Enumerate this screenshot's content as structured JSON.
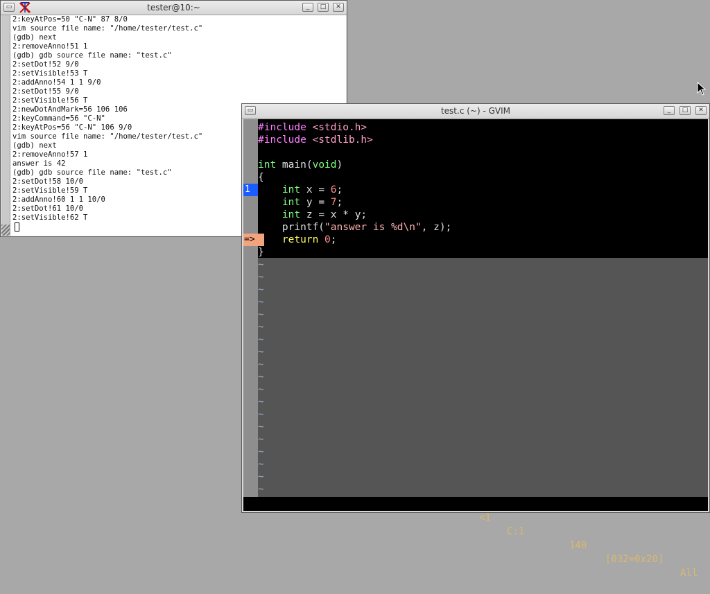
{
  "xterm": {
    "title": "tester@10:~",
    "lines": [
      "2:keyAtPos=50 \"C-N\" 87 8/0",
      "vim source file name: \"/home/tester/test.c\"",
      "(gdb) next",
      "2:removeAnno!51 1",
      "(gdb) gdb source file name: \"test.c\"",
      "2:setDot!52 9/0",
      "2:setVisible!53 T",
      "2:addAnno!54 1 1 9/0",
      "2:setDot!55 9/0",
      "2:setVisible!56 T",
      "2:newDotAndMark=56 106 106",
      "2:keyCommand=56 \"C-N\"",
      "2:keyAtPos=56 \"C-N\" 106 9/0",
      "vim source file name: \"/home/tester/test.c\"",
      "(gdb) next",
      "2:removeAnno!57 1",
      "answer is 42",
      "(gdb) gdb source file name: \"test.c\"",
      "2:setDot!58 10/0",
      "2:setVisible!59 T",
      "2:addAnno!60 1 1 10/0",
      "2:setDot!61 10/0",
      "2:setVisible!62 T"
    ]
  },
  "gvim": {
    "title": "test.c (~) - GVIM",
    "code": {
      "l1_pp": "#include",
      "l1_rest": " <stdio.h>",
      "l2_pp": "#include",
      "l2_rest": " <stdlib.h>",
      "l4_type": "int",
      "l4_rest": " main(",
      "l4_void": "void",
      "l4_close": ")",
      "l5": "{",
      "l6_type": "int",
      "l6_a": " x = ",
      "l6_num": "6",
      "l6_end": ";",
      "l7_type": "int",
      "l7_a": " y = ",
      "l7_num": "7",
      "l7_end": ";",
      "l8_type": "int",
      "l8_a": " z = x * y;",
      "l9_a": "printf(",
      "l9_str": "\"answer is %d\\n\"",
      "l9_b": ", z);",
      "l10_kw": "return",
      "l10_sp": " ",
      "l10_num": "0",
      "l10_end": ";",
      "l11": "}"
    },
    "signs": {
      "breakpoint": "1",
      "pc": "=>"
    },
    "tilde": "~",
    "status": {
      "left": "<1",
      "pos": "C:1",
      "offset": "140",
      "char": "[032=0x20]",
      "scroll": "All"
    },
    "colors": {
      "breakpoint_sign": "#1a5cff",
      "pc_sign": "#f4a47c",
      "pc_line": "#ffff60"
    }
  }
}
